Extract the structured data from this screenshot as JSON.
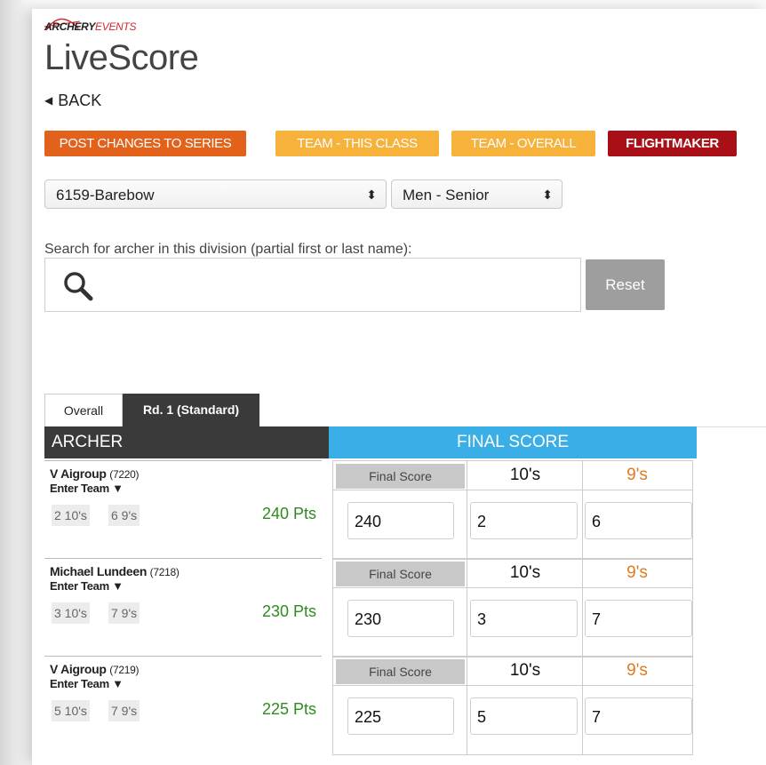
{
  "logo": {
    "brand_part1": "ARCHERY",
    "brand_part2": "EVENTS",
    "title": "LiveScore"
  },
  "nav": {
    "back_label": "BACK"
  },
  "actions": {
    "post_changes": "POST CHANGES TO SERIES",
    "team_class": "TEAM - THIS CLASS",
    "team_overall": "TEAM - OVERALL",
    "flightmaker": "FLIGHTMAKER"
  },
  "filters": {
    "division": "6159-Barebow",
    "class": "Men - Senior"
  },
  "search": {
    "label": "Search for archer in this division (partial first or last name):",
    "value": "",
    "reset_label": "Reset"
  },
  "tabs": [
    {
      "label": "Overall"
    },
    {
      "label": "Rd. 1 (Standard)"
    }
  ],
  "table": {
    "archer_header": "ARCHER",
    "score_header": "FINAL SCORE",
    "col_final": "Final Score",
    "col_tens": "10's",
    "col_nines": "9's"
  },
  "archers": [
    {
      "name": "V Aigroup",
      "id": "(7220)",
      "enter_team": "Enter Team ▼",
      "tens_badge": "2 10's",
      "nines_badge": "6 9's",
      "points": "240 Pts",
      "final_score": "240",
      "tens": "2",
      "nines": "6"
    },
    {
      "name": "Michael Lundeen",
      "id": "(7218)",
      "enter_team": "Enter Team ▼",
      "tens_badge": "3 10's",
      "nines_badge": "7 9's",
      "points": "230 Pts",
      "final_score": "230",
      "tens": "3",
      "nines": "7"
    },
    {
      "name": "V Aigroup",
      "id": "(7219)",
      "enter_team": "Enter Team ▼",
      "tens_badge": "5 10's",
      "nines_badge": "7 9's",
      "points": "225 Pts",
      "final_score": "225",
      "tens": "5",
      "nines": "7"
    }
  ],
  "colors": {
    "post": "#e2621c",
    "team": "#f7b23c",
    "flight": "#a80f16",
    "score_header": "#3aaee6",
    "points": "#2e8b1f",
    "nines": "#e07a1e"
  }
}
